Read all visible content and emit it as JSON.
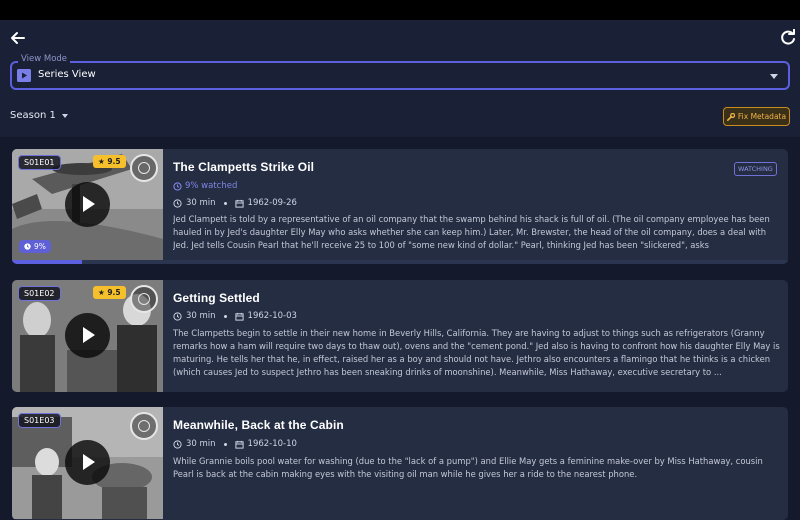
{
  "header": {
    "view_mode_label": "View Mode",
    "view_mode_value": "Series View",
    "season_label": "Season 1",
    "fix_metadata_label": "Fix Metadata"
  },
  "episodes": [
    {
      "code": "S01E01",
      "rating": "9.5",
      "title": "The Clampetts Strike Oil",
      "status_badge": "WATCHING",
      "watched_text": "9% watched",
      "progress_badge": "9%",
      "progress": 0.09,
      "duration": "30 min",
      "date": "1962-09-26",
      "description": "Jed Clampett is told by a representative of an oil company that the swamp behind his shack is full of oil. (The oil company employee has been hauled in by Jed's daughter Elly May who asks whether she can keep him.) Later, Mr. Brewster, the head of the oil company, does a deal with Jed. Jed tells Cousin Pearl that he'll receive 25 to 100 of \"some new kind of dollar.\" Pearl, thinking Jed has been \"slickered\", asks"
    },
    {
      "code": "S01E02",
      "rating": "9.5",
      "title": "Getting Settled",
      "duration": "30 min",
      "date": "1962-10-03",
      "description": "The Clampetts begin to settle in their new home in Beverly Hills, California. They are having to adjust to things such as refrigerators (Granny remarks how a ham will require two days to thaw out), ovens and the \"cement pond.\" Jed also is having to confront how his daughter Elly May is maturing. He tells her that he, in effect, raised her as a boy and should not have. Jethro also encounters a flamingo that he thinks is a chicken (which causes Jed to suspect Jethro has been sneaking drinks of moonshine). Meanwhile, Miss Hathaway, executive secretary to ..."
    },
    {
      "code": "S01E03",
      "title": "Meanwhile, Back at the Cabin",
      "duration": "30 min",
      "date": "1962-10-10",
      "description": "While Grannie boils pool water for washing (due to the \"lack of a pump\") and Ellie May gets a feminine make-over by Miss Hathaway, cousin Pearl is back at the cabin making eyes with the visiting oil man while he gives her a ride to the nearest phone."
    }
  ],
  "icons": {
    "back": "arrow-left-icon",
    "refresh": "refresh-icon",
    "view_mode": "series-icon",
    "fix": "wrench-icon",
    "star": "star-icon",
    "history": "history-icon",
    "clock": "clock-icon",
    "calendar": "calendar-icon",
    "play": "play-icon",
    "mark_watched": "circle-icon"
  },
  "colors": {
    "accent": "#5b5fe0",
    "rating": "#f5c02c",
    "fix_metadata": "#f0b347"
  }
}
